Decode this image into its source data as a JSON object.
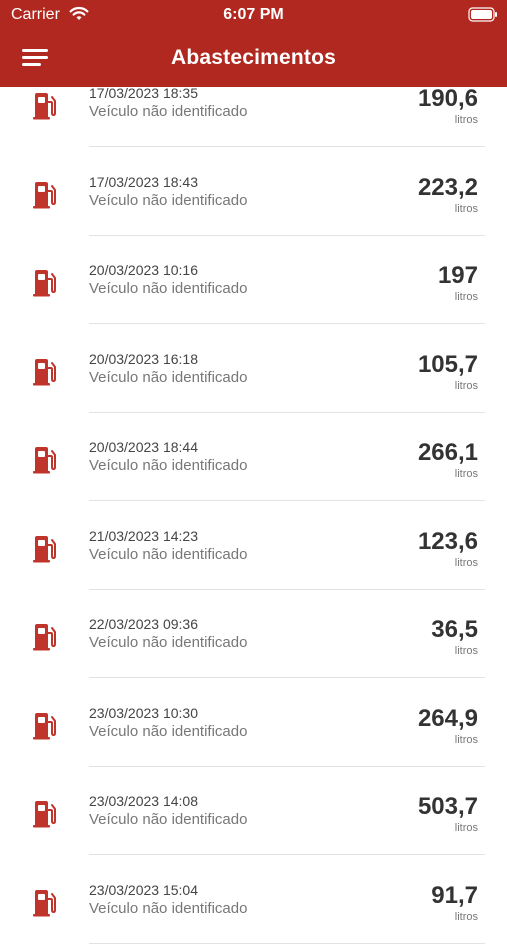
{
  "status_bar": {
    "carrier": "Carrier",
    "time": "6:07 PM"
  },
  "header": {
    "title": "Abastecimentos"
  },
  "colors": {
    "brand": "#b0281f",
    "icon": "#c0352b"
  },
  "list": {
    "items": [
      {
        "datetime": "17/03/2023 18:35",
        "vehicle": "Veículo não identificado",
        "volume": "190,6",
        "unit": "litros"
      },
      {
        "datetime": "17/03/2023 18:43",
        "vehicle": "Veículo não identificado",
        "volume": "223,2",
        "unit": "litros"
      },
      {
        "datetime": "20/03/2023 10:16",
        "vehicle": "Veículo não identificado",
        "volume": "197",
        "unit": "litros"
      },
      {
        "datetime": "20/03/2023 16:18",
        "vehicle": "Veículo não identificado",
        "volume": "105,7",
        "unit": "litros"
      },
      {
        "datetime": "20/03/2023 18:44",
        "vehicle": "Veículo não identificado",
        "volume": "266,1",
        "unit": "litros"
      },
      {
        "datetime": "21/03/2023 14:23",
        "vehicle": "Veículo não identificado",
        "volume": "123,6",
        "unit": "litros"
      },
      {
        "datetime": "22/03/2023 09:36",
        "vehicle": "Veículo não identificado",
        "volume": "36,5",
        "unit": "litros"
      },
      {
        "datetime": "23/03/2023 10:30",
        "vehicle": "Veículo não identificado",
        "volume": "264,9",
        "unit": "litros"
      },
      {
        "datetime": "23/03/2023 14:08",
        "vehicle": "Veículo não identificado",
        "volume": "503,7",
        "unit": "litros"
      },
      {
        "datetime": "23/03/2023 15:04",
        "vehicle": "Veículo não identificado",
        "volume": "91,7",
        "unit": "litros"
      }
    ]
  }
}
